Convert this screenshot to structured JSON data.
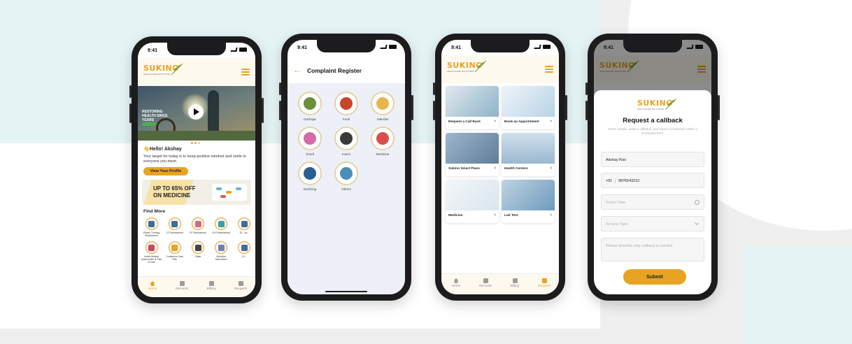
{
  "status_time": "9:41",
  "brand": {
    "name": "SUKINO",
    "tagline": "HEALTHCARE SOLUTIONS",
    "accent": "#e8a323"
  },
  "phone1": {
    "hero_caption": "RESTORING HEALTH SINCE YEARS",
    "greeting": "👋Hello! Akshay",
    "greeting_sub": "Your target for today is to keep  positive mindset and smile to everyone you meet.",
    "profile_button": "View Your Profile",
    "promo_line1": "UP TO 65% OFF",
    "promo_line2": "ON MEDICINE",
    "find_more_title": "Find More",
    "find_row1": [
      {
        "label": "Physio Therapy Assessment",
        "icon": "physio-icon"
      },
      {
        "label": "OT Assessment",
        "icon": "ot-icon"
      },
      {
        "label": "RT Assessment",
        "icon": "rt-icon"
      },
      {
        "label": "SLP Assessment",
        "icon": "slp-icon"
      },
      {
        "label": "Di... As...",
        "icon": "assessment-icon"
      }
    ],
    "find_row2": [
      {
        "label": "Initial Medical Assessment & Plan of Care",
        "icon": "medical-assessment-icon"
      },
      {
        "label": "Continuum Care Plan",
        "icon": "care-plan-icon"
      },
      {
        "label": "Vitals",
        "icon": "vitals-icon"
      },
      {
        "label": "Medicine Information",
        "icon": "medicine-info-icon"
      },
      {
        "label": "Di...",
        "icon": "more-icon"
      }
    ],
    "tabs": [
      {
        "label": "Home",
        "icon": "home-icon",
        "active": true
      },
      {
        "label": "Records",
        "icon": "records-icon",
        "active": false
      },
      {
        "label": "Billing",
        "icon": "billing-icon",
        "active": false
      },
      {
        "label": "Request",
        "icon": "request-icon",
        "active": false
      }
    ]
  },
  "phone2": {
    "title": "Complaint Register",
    "categories": [
      {
        "label": "Garbage",
        "icon": "garbage-icon",
        "color": "#6b8f3a"
      },
      {
        "label": "Food",
        "icon": "food-icon",
        "color": "#c8462c"
      },
      {
        "label": "Attender",
        "icon": "attender-icon",
        "color": "#e7b54a"
      },
      {
        "label": "Smell",
        "icon": "smell-icon",
        "color": "#d76aa7"
      },
      {
        "label": "Insect",
        "icon": "insect-icon",
        "color": "#3a3a3a"
      },
      {
        "label": "Medicine",
        "icon": "medicine-icon",
        "color": "#d94d4d"
      },
      {
        "label": "Nurshing",
        "icon": "nursing-icon",
        "color": "#2b5e92"
      },
      {
        "label": "Others",
        "icon": "others-icon",
        "color": "#4a8fb6"
      }
    ]
  },
  "phone3": {
    "tiles": [
      {
        "label": "Request a Call Back",
        "color": "#8fb3c9"
      },
      {
        "label": "Book an Appointment",
        "color": "#b9d3e6"
      },
      {
        "label": "Sukino Smart Plans",
        "color": "#5f7d99"
      },
      {
        "label": "Health Centers",
        "color": "#9bb7cf"
      },
      {
        "label": "Medicine",
        "color": "#d9e6ee"
      },
      {
        "label": "Lab Test",
        "color": "#6f9bbd"
      }
    ],
    "tabs": [
      {
        "label": "Home",
        "icon": "home-icon",
        "active": false
      },
      {
        "label": "Records",
        "icon": "records-icon",
        "active": false
      },
      {
        "label": "Billing",
        "icon": "billing-icon",
        "active": false
      },
      {
        "label": "Request",
        "icon": "request-icon",
        "active": true
      }
    ]
  },
  "phone4": {
    "title": "Request a callback",
    "subtitle": "Share details, await a callback, and expect a response within a scheduled time.",
    "name_value": "Akshay Rao",
    "country_code": "+91",
    "phone_value": "9876543210",
    "time_placeholder": "Select Time",
    "service_placeholder": "Service Type",
    "reason_placeholder": "Please describe why callback is needed",
    "submit_label": "Submit"
  }
}
